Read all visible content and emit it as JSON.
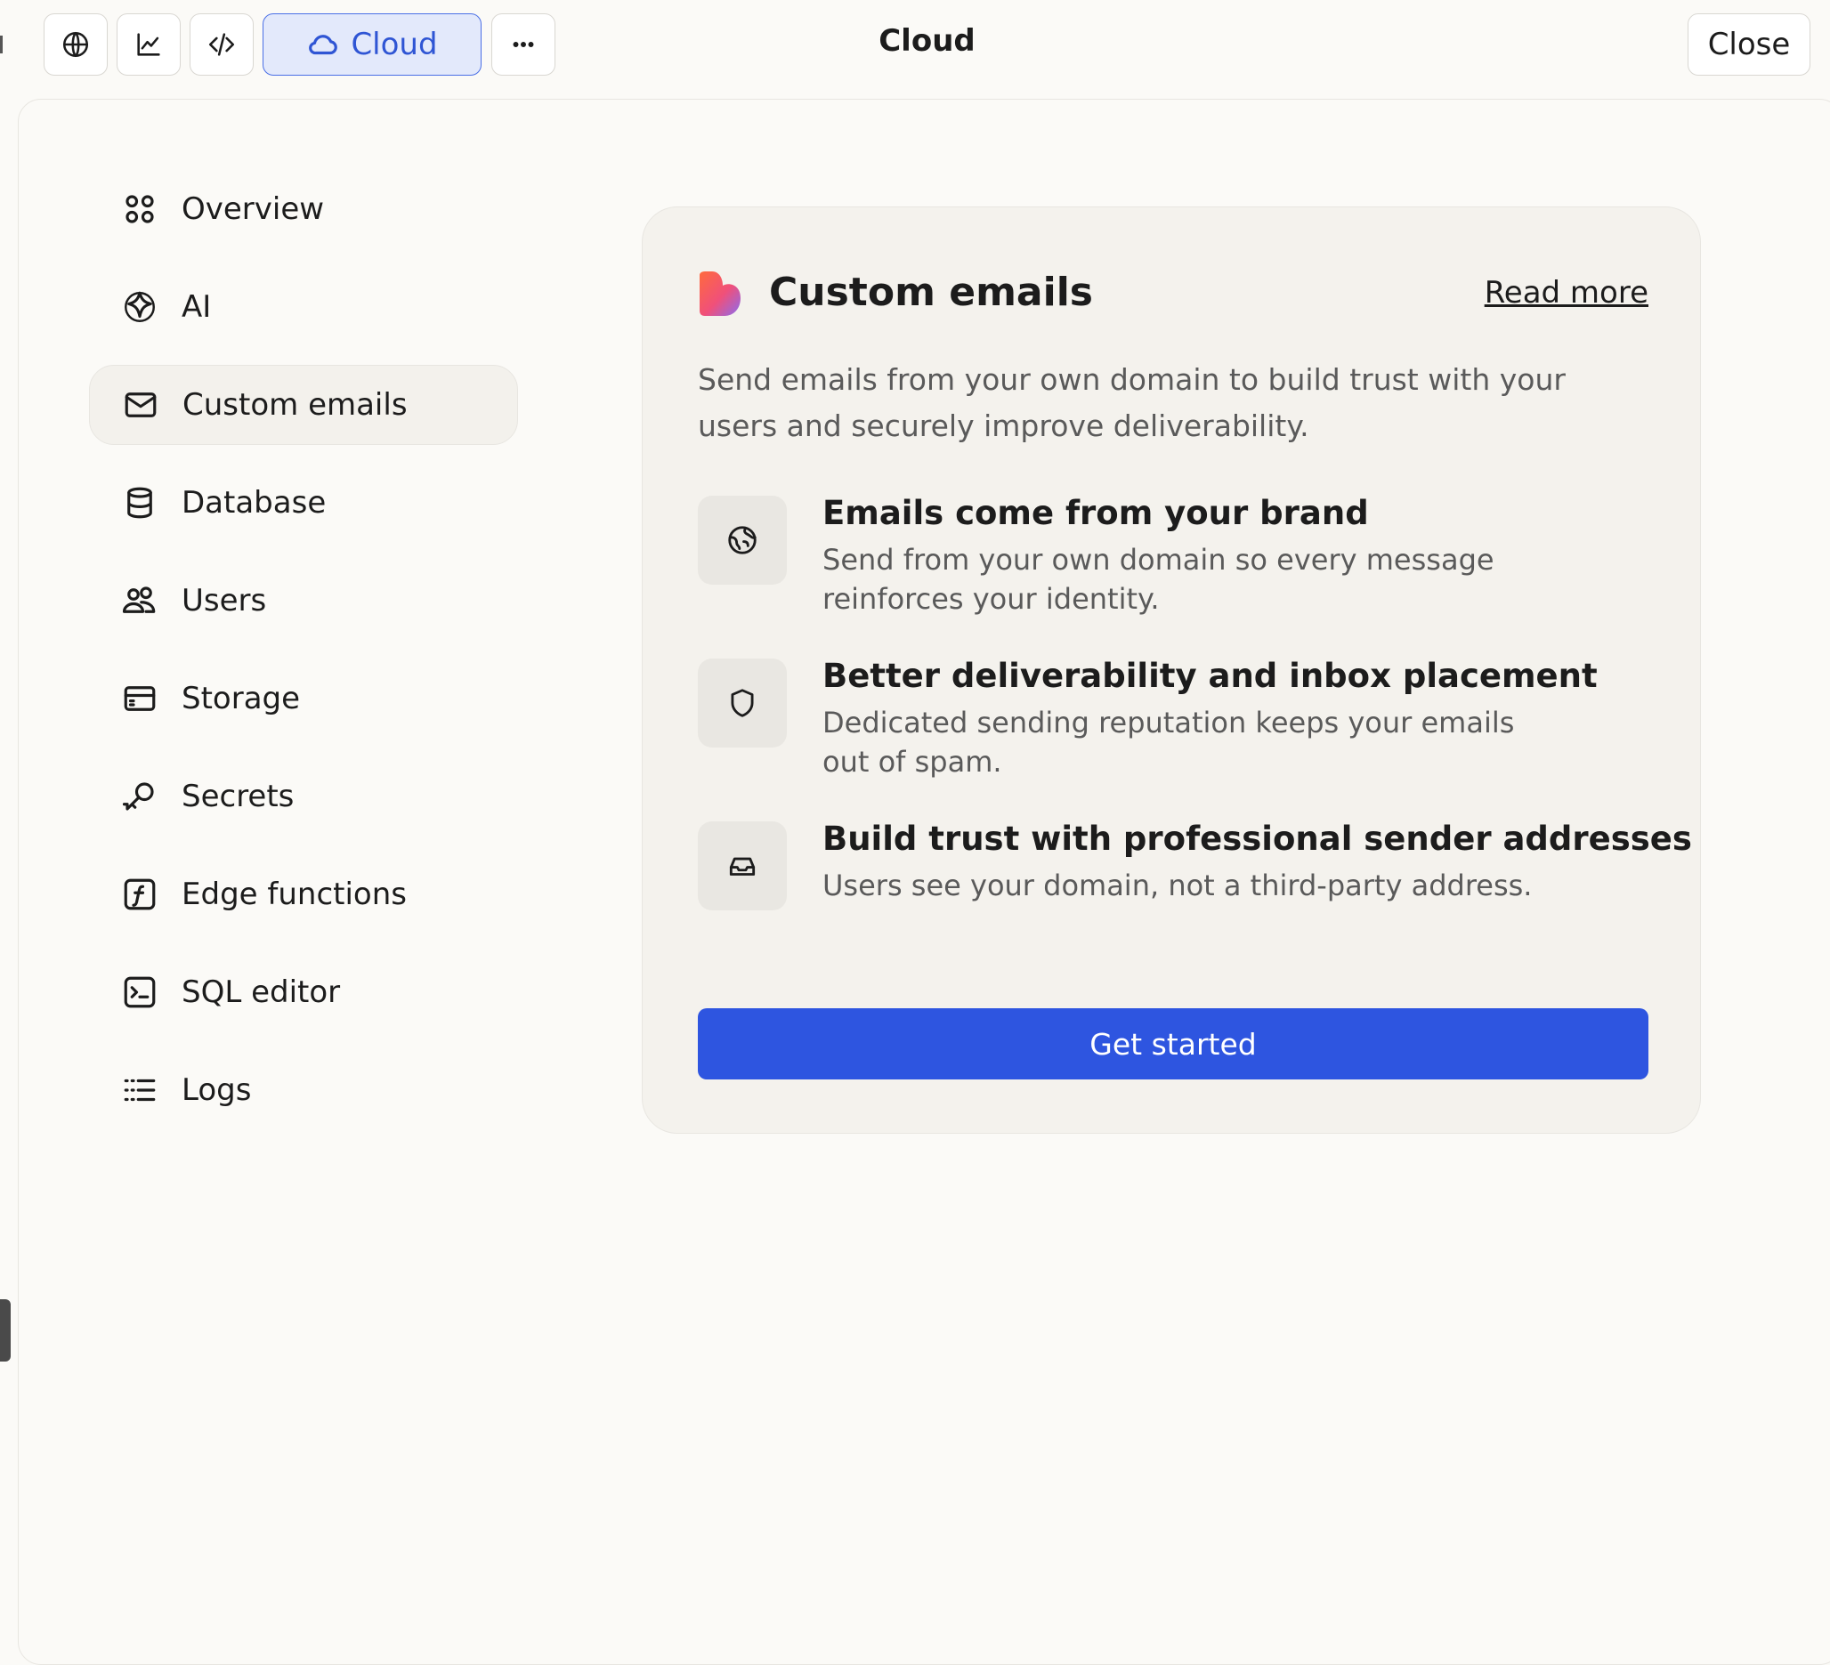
{
  "toolbar": {
    "cloud_label": "Cloud",
    "title": "Cloud",
    "close_label": "Close"
  },
  "nav": [
    {
      "label": "Overview",
      "icon": "grid-icon"
    },
    {
      "label": "AI",
      "icon": "sparkle-icon"
    },
    {
      "label": "Custom emails",
      "icon": "mail-icon",
      "active": true
    },
    {
      "label": "Database",
      "icon": "database-icon"
    },
    {
      "label": "Users",
      "icon": "users-icon"
    },
    {
      "label": "Storage",
      "icon": "storage-icon"
    },
    {
      "label": "Secrets",
      "icon": "key-icon"
    },
    {
      "label": "Edge functions",
      "icon": "function-icon"
    },
    {
      "label": "SQL editor",
      "icon": "terminal-icon"
    },
    {
      "label": "Logs",
      "icon": "list-icon"
    }
  ],
  "card": {
    "title": "Custom emails",
    "read_more": "Read more",
    "description": "Send emails from your own domain to build trust with your users and securely improve deliverability.",
    "features": [
      {
        "icon": "globe-icon",
        "title": "Emails come from your brand",
        "text": "Send from your own domain so every message reinforces your identity."
      },
      {
        "icon": "shield-icon",
        "title": "Better deliverability and inbox placement",
        "text": "Dedicated sending reputation keeps your emails out of spam."
      },
      {
        "icon": "inbox-icon",
        "title": "Build trust with professional sender addresses",
        "text": "Users see your domain, not a third-party address."
      }
    ],
    "cta_label": "Get started"
  },
  "colors": {
    "accent": "#2e55e0",
    "cloud_bg": "#e3e9fb",
    "panel_bg": "#fbfaf7",
    "card_bg": "#f4f2ed"
  }
}
